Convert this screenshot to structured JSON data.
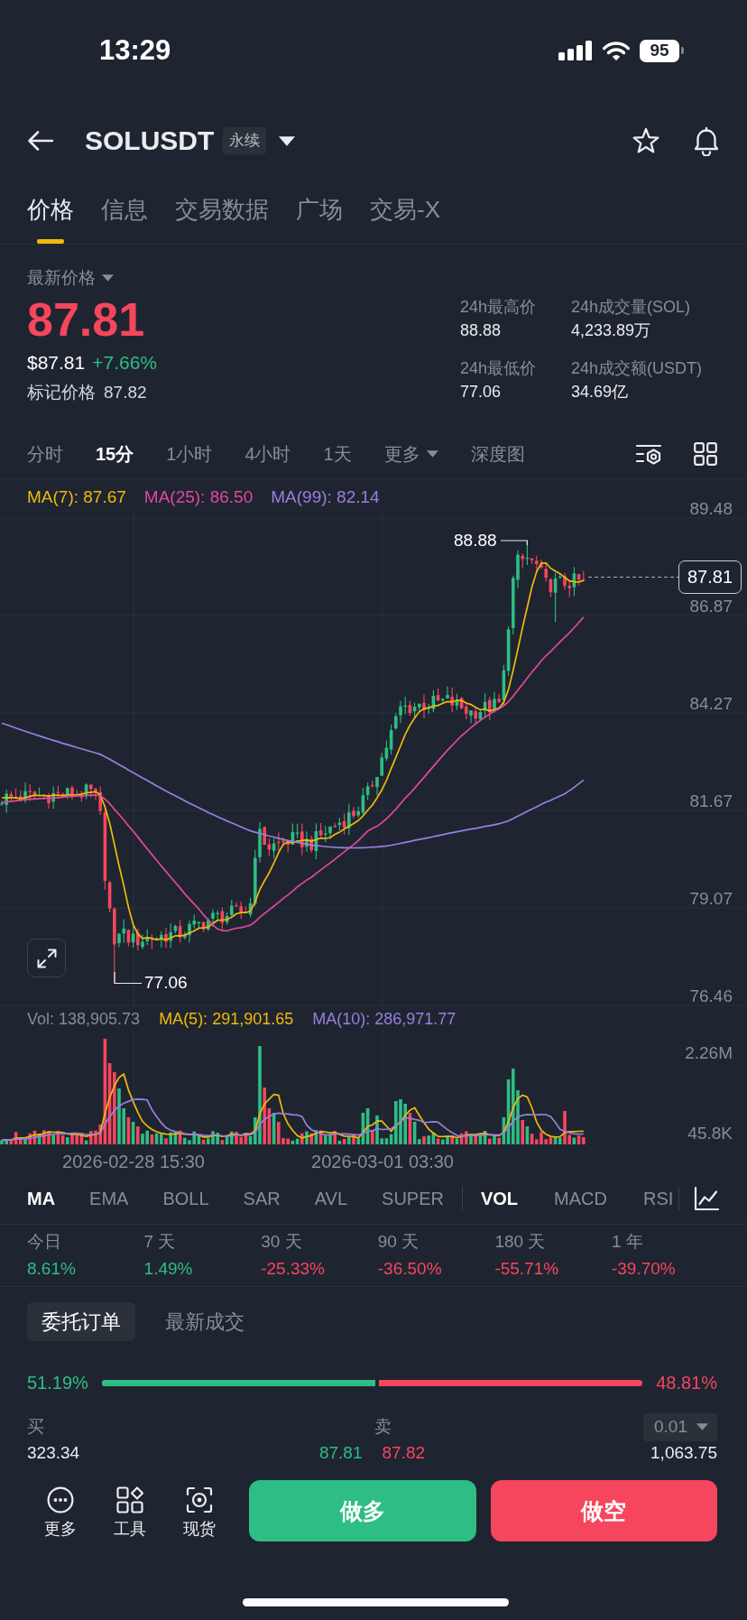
{
  "status_bar": {
    "time": "13:29",
    "battery": "95"
  },
  "header": {
    "symbol": "SOLUSDT",
    "tag": "永续"
  },
  "tabs": [
    {
      "label": "价格",
      "selected": true
    },
    {
      "label": "信息",
      "selected": false
    },
    {
      "label": "交易数据",
      "selected": false
    },
    {
      "label": "广场",
      "selected": false
    },
    {
      "label": "交易-X",
      "selected": false
    }
  ],
  "price": {
    "label": "最新价格",
    "last": "87.81",
    "usd": "$87.81",
    "change": "+7.66%",
    "mark_label": "标记价格",
    "mark": "87.82"
  },
  "stats": [
    {
      "label": "24h最高价",
      "value": "88.88"
    },
    {
      "label": "24h成交量(SOL)",
      "value": "4,233.89万"
    },
    {
      "label": "24h最低价",
      "value": "77.06"
    },
    {
      "label": "24h成交额(USDT)",
      "value": "34.69亿"
    }
  ],
  "intervals": [
    {
      "label": "分时",
      "selected": false,
      "kind": "interval"
    },
    {
      "label": "15分",
      "selected": true,
      "kind": "interval"
    },
    {
      "label": "1小时",
      "selected": false,
      "kind": "interval"
    },
    {
      "label": "4小时",
      "selected": false,
      "kind": "interval"
    },
    {
      "label": "1天",
      "selected": false,
      "kind": "interval"
    },
    {
      "label": "更多",
      "selected": false,
      "kind": "menu"
    },
    {
      "label": "深度图",
      "selected": false,
      "kind": "interval"
    }
  ],
  "chart": {
    "legend": [
      {
        "label": "MA(7): 87.67",
        "color": "#f0b90b"
      },
      {
        "label": "MA(25): 86.50",
        "color": "#e2479f"
      },
      {
        "label": "MA(99): 82.14",
        "color": "#9a7fdc"
      }
    ],
    "price_labels": [
      "89.48",
      "86.87",
      "84.27",
      "81.67",
      "79.07",
      "76.46"
    ],
    "last_price": "87.81",
    "high": "88.88",
    "low": "77.06"
  },
  "volume": {
    "legend": [
      {
        "label": "Vol: 138,905.73",
        "color": "#848e9c"
      },
      {
        "label": "MA(5): 291,901.65",
        "color": "#f0b90b"
      },
      {
        "label": "MA(10): 286,971.77",
        "color": "#9a7fdc"
      }
    ],
    "axis_labels": [
      "2.26M",
      "45.8K"
    ],
    "dates": [
      "2026-02-28 15:30",
      "2026-03-01 03:30"
    ]
  },
  "indicators": {
    "main": [
      {
        "label": "MA",
        "selected": true
      },
      {
        "label": "EMA",
        "selected": false
      },
      {
        "label": "BOLL",
        "selected": false
      },
      {
        "label": "SAR",
        "selected": false
      },
      {
        "label": "AVL",
        "selected": false
      },
      {
        "label": "SUPER",
        "selected": false
      }
    ],
    "sub": [
      {
        "label": "VOL",
        "selected": true
      },
      {
        "label": "MACD",
        "selected": false
      },
      {
        "label": "RSI",
        "selected": false
      }
    ]
  },
  "performance": [
    {
      "period": "今日",
      "change": "8.61%",
      "color": "#2ebd85"
    },
    {
      "period": "7 天",
      "change": "1.49%",
      "color": "#2ebd85"
    },
    {
      "period": "30 天",
      "change": "-25.33%",
      "color": "#f6465d"
    },
    {
      "period": "90 天",
      "change": "-36.50%",
      "color": "#f6465d"
    },
    {
      "period": "180 天",
      "change": "-55.71%",
      "color": "#f6465d"
    },
    {
      "period": "1 年",
      "change": "-39.70%",
      "color": "#f6465d"
    }
  ],
  "order_book": {
    "tabs": [
      {
        "label": "委托订单",
        "selected": true
      },
      {
        "label": "最新成交",
        "selected": false
      }
    ],
    "buy_ratio": "51.19%",
    "sell_ratio": "48.81%",
    "level": 0.5119,
    "buy_label": "买",
    "sell_label": "卖",
    "precision": "0.01",
    "rows": [
      {
        "bid_quantity": "323.34",
        "bid_price": "87.81",
        "ask_price": "87.82",
        "ask_quantity": "1,063.75"
      }
    ]
  },
  "bottom_bar": {
    "tools": [
      {
        "label": "更多"
      },
      {
        "label": "工具"
      },
      {
        "label": "现货"
      }
    ],
    "long": "做多",
    "short": "做空"
  }
}
